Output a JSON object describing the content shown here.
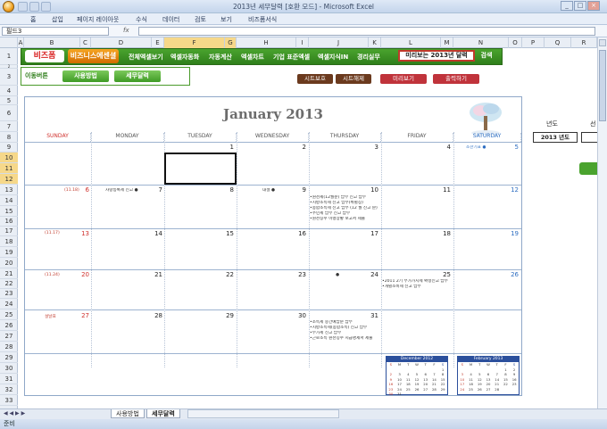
{
  "window": {
    "title": "2013년 세무달력 [호환 모드] - Microsoft Excel"
  },
  "ribbon": {
    "tabs": [
      "홈",
      "삽입",
      "페이지 레이아웃",
      "수식",
      "데이터",
      "검토",
      "보기",
      "비즈폼서식"
    ]
  },
  "formula": {
    "name_box": "필드3",
    "fx": "fx"
  },
  "columns": [
    "A",
    "B",
    "C",
    "D",
    "E",
    "F",
    "G",
    "H",
    "I",
    "J",
    "K",
    "L",
    "M",
    "N",
    "O",
    "P",
    "Q",
    "R"
  ],
  "rows": [
    "1",
    "2",
    "3",
    "4",
    "5",
    "6",
    "7",
    "8",
    "9",
    "10",
    "11",
    "12",
    "13",
    "14",
    "15",
    "16",
    "17",
    "18",
    "19",
    "20",
    "21",
    "22",
    "23",
    "24",
    "25",
    "26",
    "27",
    "28",
    "29",
    "30",
    "31",
    "32",
    "33"
  ],
  "topbar": {
    "logo": "비즈폼",
    "brand": "비즈니스에센셜",
    "items": [
      "전체엑셀보기",
      "엑셀자동화",
      "자동계산",
      "엑셀차트",
      "기업 표준엑셀",
      "엑셀지식IN",
      "경리실무"
    ],
    "preview_2013": "미리보는 2013년 달력",
    "search": "검색"
  },
  "nav": {
    "label": "이동버튼",
    "btn1": "사용방법",
    "btn2": "세무달력",
    "protect": "시트보호",
    "unprotect": "시트해제",
    "preview": "미리보기",
    "print": "출력하기"
  },
  "calendar": {
    "title": "January 2013",
    "days": [
      "SUNDAY",
      "MONDAY",
      "TUESDAY",
      "WEDNESDAY",
      "THURSDAY",
      "FRIDAY",
      "SATURDAY"
    ],
    "weeks": [
      [
        "",
        "",
        "1",
        "2",
        "3",
        "4",
        "5"
      ],
      [
        "6",
        "7",
        "8",
        "9",
        "10",
        "11",
        "12"
      ],
      [
        "13",
        "14",
        "15",
        "16",
        "17",
        "18",
        "19"
      ],
      [
        "20",
        "21",
        "22",
        "23",
        "24",
        "25",
        "26"
      ],
      [
        "27",
        "28",
        "29",
        "30",
        "31",
        "",
        ""
      ]
    ],
    "lunar": {
      "w1": "(11.18)",
      "w2": "(11.17)",
      "w3": "(11.24)",
      "w4": "설날표"
    },
    "events": {
      "sat5": "소한기표 ●",
      "mon7": "차량등록세 신고 ●",
      "wed9": "대설 ●",
      "thu10": [
        "•원천세(12월분) 납부 신고 납부",
        "•지방소득세 신고 납부(특별징)",
        "•종합소득세 신고 납부 (12 월 신고 분)",
        "•주민세 납부 신고 납부",
        "•원천징수 이행상황 보고서 제출"
      ],
      "thu24": "●",
      "fri25": [
        "•2011 2기 부가가치세 확정신고 납부",
        "•개별소비세 신고 납부"
      ],
      "thu31": [
        "•소득세 중간예납분 납부",
        "•지방소득세(종합소득) 신고 납부",
        "•부가세 신고 납부",
        "•근로소득 원천징수 지급명세서 제출"
      ]
    },
    "mini_dec": {
      "title": "December 2012",
      "days": [
        "S",
        "M",
        "T",
        "W",
        "T",
        "F",
        "S"
      ],
      "cells": [
        "",
        "",
        "",
        "",
        "",
        "",
        "1",
        "2",
        "3",
        "4",
        "5",
        "6",
        "7",
        "8",
        "9",
        "10",
        "11",
        "12",
        "13",
        "14",
        "15",
        "16",
        "17",
        "18",
        "19",
        "20",
        "21",
        "22",
        "23",
        "24",
        "25",
        "26",
        "27",
        "28",
        "29",
        "30",
        "31",
        "",
        "",
        "",
        "",
        ""
      ]
    },
    "mini_feb": {
      "title": "February 2013",
      "days": [
        "S",
        "M",
        "T",
        "W",
        "T",
        "F",
        "S"
      ],
      "cells": [
        "",
        "",
        "",
        "",
        "",
        "1",
        "2",
        "3",
        "4",
        "5",
        "6",
        "7",
        "8",
        "9",
        "10",
        "11",
        "12",
        "13",
        "14",
        "15",
        "16",
        "17",
        "18",
        "19",
        "20",
        "21",
        "22",
        "23",
        "24",
        "25",
        "26",
        "27",
        "28",
        "",
        "",
        ""
      ]
    }
  },
  "right": {
    "year_label": "년도",
    "year_value": "2013 년도",
    "month_label": "선"
  },
  "sheets": [
    "사용방법",
    "세무달력"
  ],
  "status": {
    "ready": "준비"
  }
}
